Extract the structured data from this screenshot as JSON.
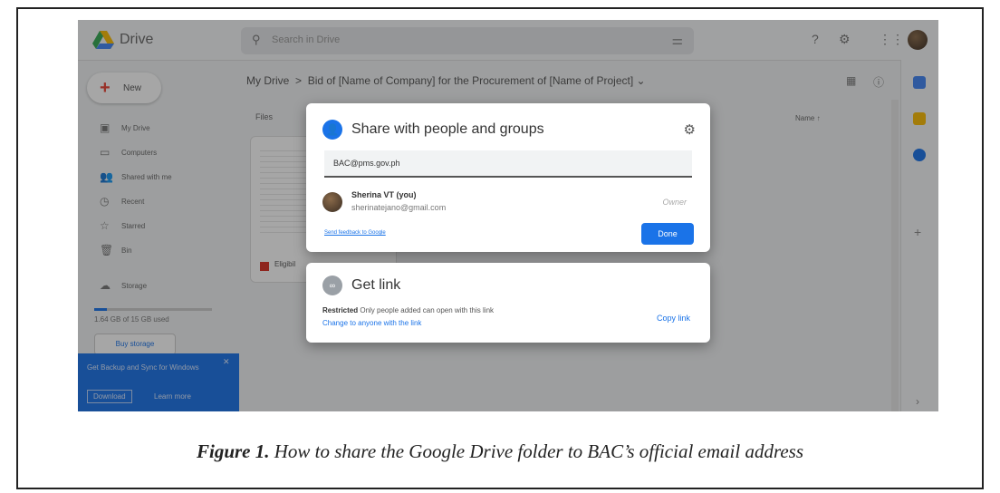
{
  "drive": {
    "brand": "Drive",
    "search_placeholder": "Search in Drive",
    "new_label": "New",
    "nav": [
      {
        "label": "My Drive",
        "icon": "my-drive-icon",
        "glyph": "▣"
      },
      {
        "label": "Computers",
        "icon": "computers-icon",
        "glyph": "▭"
      },
      {
        "label": "Shared with me",
        "icon": "shared-icon",
        "glyph": "👥"
      },
      {
        "label": "Recent",
        "icon": "clock-icon",
        "glyph": "◷"
      },
      {
        "label": "Starred",
        "icon": "star-icon",
        "glyph": "☆"
      },
      {
        "label": "Bin",
        "icon": "bin-icon",
        "glyph": "🗑"
      },
      {
        "label": "Storage",
        "icon": "cloud-icon",
        "glyph": "☁"
      }
    ],
    "storage_text": "1.64 GB of 15 GB used",
    "storage_used_fraction": 0.11,
    "buy_storage": "Buy storage",
    "promo_text": "Get Backup and Sync for Windows",
    "promo_download": "Download",
    "promo_learn": "Learn more",
    "breadcrumb_root": "My Drive",
    "breadcrumb_sep": ">",
    "breadcrumb_folder": "Bid of [Name of Company] for the Procurement of [Name of Project]",
    "files_label": "Files",
    "name_sort_label": "Name ↑",
    "file_name": "Eligibil"
  },
  "share_dialog": {
    "title": "Share with people and groups",
    "email_value": "BAC@pms.gov.ph",
    "person_name": "Sherina VT (you)",
    "person_email": "sherinatejano@gmail.com",
    "person_role": "Owner",
    "feedback_link": "Send feedback to Google",
    "done_label": "Done"
  },
  "link_dialog": {
    "title": "Get link",
    "restricted_label": "Restricted",
    "restricted_desc": "Only people added can open with this link",
    "change_link": "Change to anyone with the link",
    "copy_link": "Copy link"
  },
  "caption": {
    "figure_label": "Figure 1.",
    "text": "How to share the Google Drive folder to BAC’s official email address"
  },
  "colors": {
    "accent": "#1a73e8",
    "promo_bg": "#1a73e8",
    "file_icon": "#d93025"
  }
}
